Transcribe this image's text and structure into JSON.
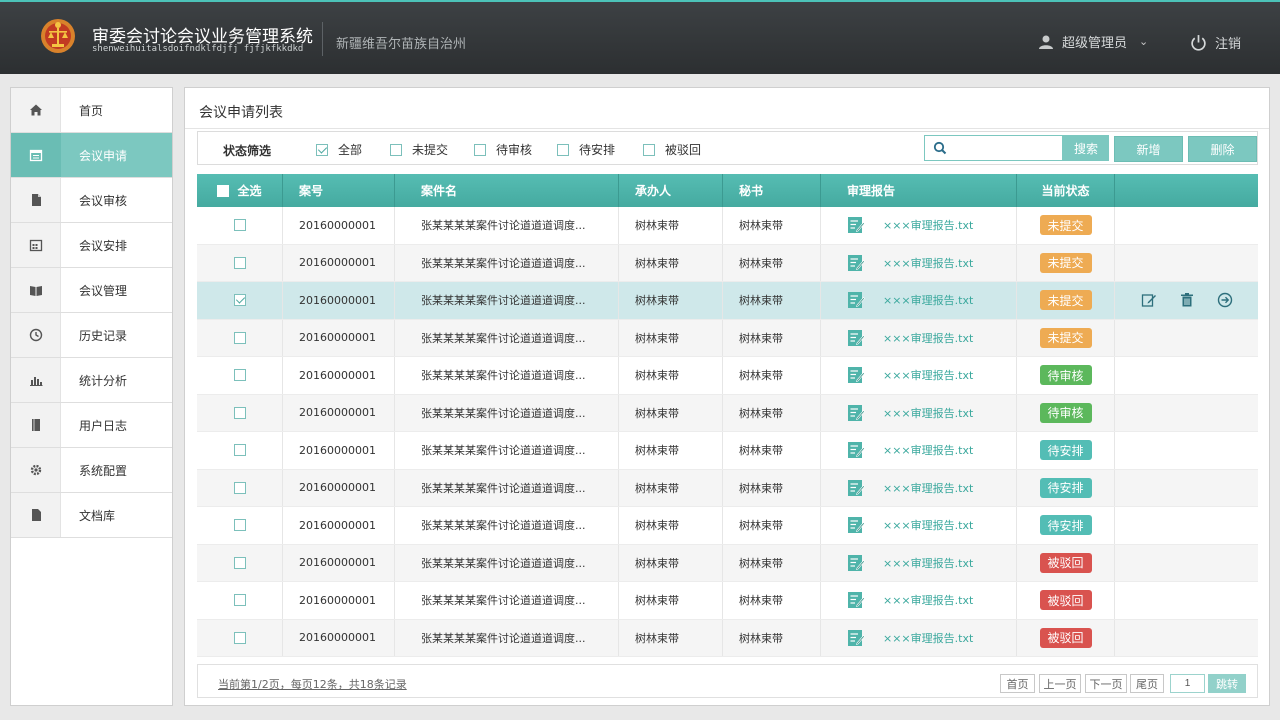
{
  "header": {
    "system_title": "审委会讨论会议业务管理系统",
    "system_subtitle": "shenweihuitalsdoifndklfdjfj fjfjkfkkdkd",
    "region": "新疆维吾尔苗族自治州",
    "user_name": "超级管理员",
    "logout_label": "注销",
    "logo_icon": "court-emblem-icon"
  },
  "sidebar": {
    "items": [
      {
        "label": "首页",
        "icon": "home-icon",
        "active": false
      },
      {
        "label": "会议申请",
        "icon": "calendar-icon",
        "active": true
      },
      {
        "label": "会议审核",
        "icon": "document-icon",
        "active": false
      },
      {
        "label": "会议安排",
        "icon": "schedule-icon",
        "active": false
      },
      {
        "label": "会议管理",
        "icon": "book-icon",
        "active": false
      },
      {
        "label": "历史记录",
        "icon": "clock-icon",
        "active": false
      },
      {
        "label": "统计分析",
        "icon": "bar-chart-icon",
        "active": false
      },
      {
        "label": "用户日志",
        "icon": "log-icon",
        "active": false
      },
      {
        "label": "系统配置",
        "icon": "gear-icon",
        "active": false
      },
      {
        "label": "文档库",
        "icon": "file-icon",
        "active": false
      }
    ]
  },
  "main": {
    "title": "会议申请列表",
    "filter": {
      "label": "状态筛选",
      "options": [
        {
          "label": "全部",
          "checked": true
        },
        {
          "label": "未提交",
          "checked": false
        },
        {
          "label": "待审核",
          "checked": false
        },
        {
          "label": "待安排",
          "checked": false
        },
        {
          "label": "被驳回",
          "checked": false
        }
      ]
    },
    "search": {
      "placeholder": "",
      "button_label": "搜索"
    },
    "buttons": {
      "add_label": "新增",
      "delete_label": "删除"
    },
    "table": {
      "headers": {
        "select_all": "全选",
        "case_no": "案号",
        "case_name": "案件名",
        "handler": "承办人",
        "secretary": "秘书",
        "report": "审理报告",
        "status": "当前状态"
      },
      "rows": [
        {
          "checked": false,
          "case_no": "20160000001",
          "case_name": "张某某某某案件讨论道道道调度...",
          "handler": "树林束带",
          "secretary": "树林束带",
          "report": "×××审理报告.txt",
          "status": "未提交",
          "selected": false
        },
        {
          "checked": false,
          "case_no": "20160000001",
          "case_name": "张某某某某案件讨论道道道调度...",
          "handler": "树林束带",
          "secretary": "树林束带",
          "report": "×××审理报告.txt",
          "status": "未提交",
          "selected": false
        },
        {
          "checked": true,
          "case_no": "20160000001",
          "case_name": "张某某某某案件讨论道道道调度...",
          "handler": "树林束带",
          "secretary": "树林束带",
          "report": "×××审理报告.txt",
          "status": "未提交",
          "selected": true
        },
        {
          "checked": false,
          "case_no": "20160000001",
          "case_name": "张某某某某案件讨论道道道调度...",
          "handler": "树林束带",
          "secretary": "树林束带",
          "report": "×××审理报告.txt",
          "status": "未提交",
          "selected": false
        },
        {
          "checked": false,
          "case_no": "20160000001",
          "case_name": "张某某某某案件讨论道道道调度...",
          "handler": "树林束带",
          "secretary": "树林束带",
          "report": "×××审理报告.txt",
          "status": "待审核",
          "selected": false
        },
        {
          "checked": false,
          "case_no": "20160000001",
          "case_name": "张某某某某案件讨论道道道调度...",
          "handler": "树林束带",
          "secretary": "树林束带",
          "report": "×××审理报告.txt",
          "status": "待审核",
          "selected": false
        },
        {
          "checked": false,
          "case_no": "20160000001",
          "case_name": "张某某某某案件讨论道道道调度...",
          "handler": "树林束带",
          "secretary": "树林束带",
          "report": "×××审理报告.txt",
          "status": "待安排",
          "selected": false
        },
        {
          "checked": false,
          "case_no": "20160000001",
          "case_name": "张某某某某案件讨论道道道调度...",
          "handler": "树林束带",
          "secretary": "树林束带",
          "report": "×××审理报告.txt",
          "status": "待安排",
          "selected": false
        },
        {
          "checked": false,
          "case_no": "20160000001",
          "case_name": "张某某某某案件讨论道道道调度...",
          "handler": "树林束带",
          "secretary": "树林束带",
          "report": "×××审理报告.txt",
          "status": "待安排",
          "selected": false
        },
        {
          "checked": false,
          "case_no": "20160000001",
          "case_name": "张某某某某案件讨论道道道调度...",
          "handler": "树林束带",
          "secretary": "树林束带",
          "report": "×××审理报告.txt",
          "status": "被驳回",
          "selected": false
        },
        {
          "checked": false,
          "case_no": "20160000001",
          "case_name": "张某某某某案件讨论道道道调度...",
          "handler": "树林束带",
          "secretary": "树林束带",
          "report": "×××审理报告.txt",
          "status": "被驳回",
          "selected": false
        },
        {
          "checked": false,
          "case_no": "20160000001",
          "case_name": "张某某某某案件讨论道道道调度...",
          "handler": "树林束带",
          "secretary": "树林束带",
          "report": "×××审理报告.txt",
          "status": "被驳回",
          "selected": false
        }
      ],
      "row_actions": [
        "edit-icon",
        "trash-icon",
        "arrow-right-circle-icon"
      ]
    },
    "status_colors": {
      "未提交": "#eeab53",
      "待审核": "#5cb85c",
      "待安排": "#53bdb5",
      "被驳回": "#d9534f"
    },
    "pagination": {
      "info": "当前第1/2页，每页12条，共18条记录",
      "first_label": "首页",
      "prev_label": "上一页",
      "next_label": "下一页",
      "last_label": "尾页",
      "page_value": "1",
      "go_label": "跳转"
    }
  },
  "colors": {
    "accent": "#7cc8c0",
    "header_bg": "#36393b",
    "table_header": "#4fb4aa"
  }
}
